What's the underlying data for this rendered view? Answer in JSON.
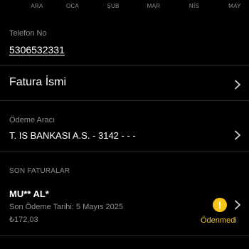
{
  "timeline": {
    "months": [
      "ARA",
      "OCA",
      "ŞUB",
      "MAR",
      "NİS",
      "MAY"
    ]
  },
  "phone": {
    "label": "Telefon No",
    "value": "5306532331"
  },
  "invoice_name": {
    "label": "Fatura İsmi",
    "icon": "chevron-right-icon"
  },
  "payment_method": {
    "label": "Ödeme Aracı",
    "value": "T. IS BANKASI A.S. - 3142 -  -  -",
    "icon": "chevron-right-icon"
  },
  "recent_bills": {
    "header": "SON FATURALAR",
    "items": [
      {
        "title": "MU** AL*",
        "last_payment_date": "Son Ödeme Tarihi: 5 Mayıs 2025",
        "amount": "₺172,03",
        "status": "Ödenmedi",
        "status_icon": "warning-icon",
        "status_color": "#f5c518"
      }
    ]
  },
  "colors": {
    "background": "#000000",
    "text_primary": "#ffffff",
    "text_secondary": "#8e8e93",
    "divider": "#2c2c2e",
    "warning": "#f5c518"
  }
}
